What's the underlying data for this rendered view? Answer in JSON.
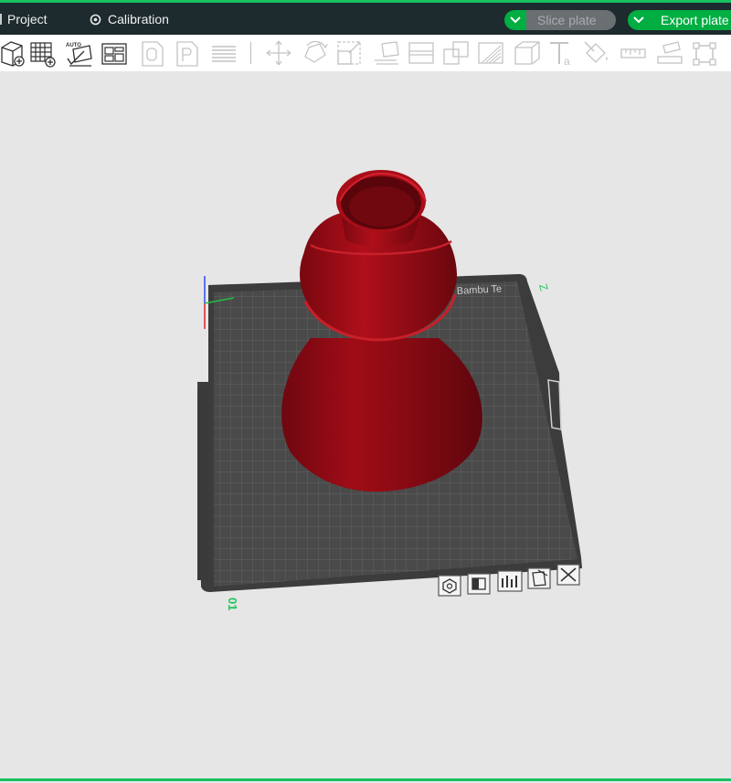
{
  "tabs": {
    "project": "Project",
    "calibration": "Calibration"
  },
  "actions": {
    "slice_plate": "Slice plate",
    "export_plate": "Export plate"
  },
  "toolbar": {
    "icons": [
      "add-cube-icon",
      "add-plate-icon",
      "auto-arrange-icon",
      "layout-icon",
      "orient-icon",
      "print-icon",
      "layers-icon",
      "move-icon",
      "rotate-icon",
      "scale-icon",
      "lay-flat-icon",
      "split-icon",
      "cut-icon",
      "support-icon",
      "box-icon",
      "text-icon",
      "paint-icon",
      "measure-icon",
      "assembly-icon",
      "frame-icon"
    ],
    "auto_label": "AUTO"
  },
  "bed": {
    "brand_text": "Bambu Te",
    "plate_number": "01",
    "corner_mark": "Z"
  },
  "plate_controls": {
    "icons": [
      "plate-settings-icon",
      "plate-lock-icon",
      "plate-arrange-icon",
      "plate-orient-icon",
      "plate-close-icon"
    ]
  },
  "colors": {
    "accent": "#00ae42",
    "topbar": "#1d2a2e",
    "model": "#8b0a12",
    "bed": "#4a4a4a"
  }
}
